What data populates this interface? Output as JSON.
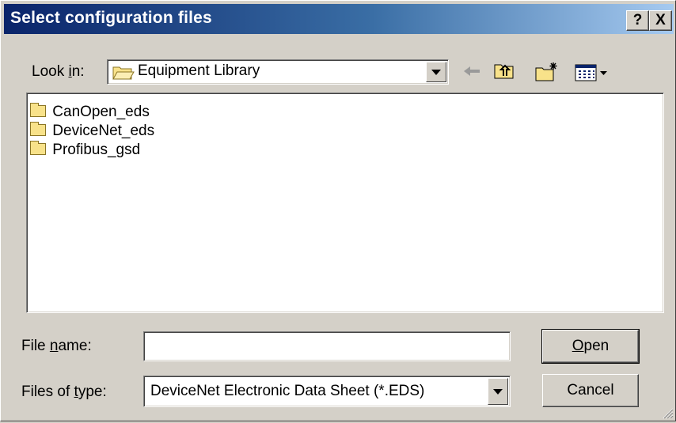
{
  "window": {
    "title": "Select configuration files",
    "help_label": "?",
    "close_label": "X"
  },
  "lookin": {
    "label_pre": "Look ",
    "label_key": "i",
    "label_post": "n:",
    "value": "Equipment Library",
    "icon": "folder-open-icon"
  },
  "toolbar": {
    "back_icon": "back-arrow-icon",
    "up_icon": "up-one-level-icon",
    "new_folder_icon": "new-folder-icon",
    "view_icon": "view-menu-icon"
  },
  "files": [
    {
      "name": "CanOpen_eds",
      "icon": "folder-icon"
    },
    {
      "name": "DeviceNet_eds",
      "icon": "folder-icon"
    },
    {
      "name": "Profibus_gsd",
      "icon": "folder-icon"
    }
  ],
  "filename": {
    "label_pre": "File ",
    "label_key": "n",
    "label_post": "ame:",
    "value": ""
  },
  "filetype": {
    "label_pre": "Files of ",
    "label_key": "t",
    "label_post": "ype:",
    "value": "DeviceNet Electronic Data Sheet (*.EDS)"
  },
  "buttons": {
    "open_key": "O",
    "open_rest": "pen",
    "cancel": "Cancel"
  },
  "colors": {
    "titlebar_start": "#0a246a",
    "titlebar_end": "#a6caf0",
    "face": "#d4d0c8",
    "folder": "#f8e28a"
  }
}
